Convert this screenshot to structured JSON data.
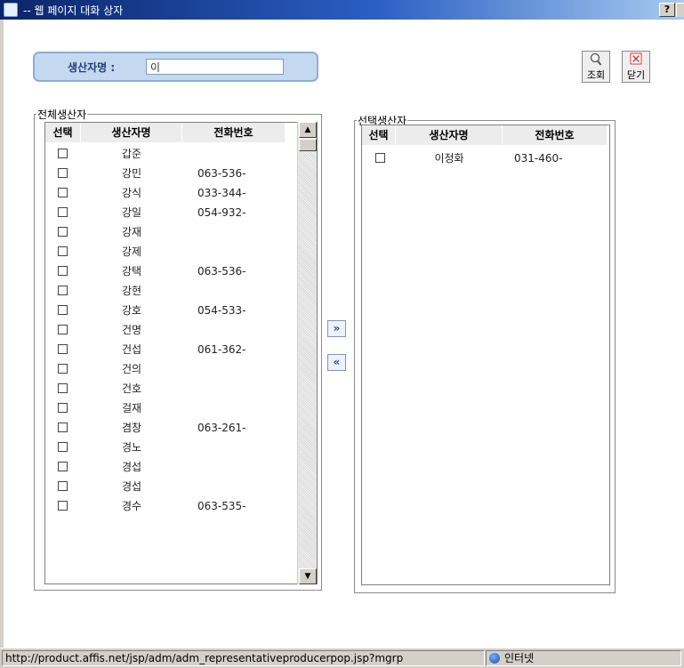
{
  "window": {
    "title": "-- 웹 페이지 대화 상자",
    "help_label": "?"
  },
  "search": {
    "label": "생산자명 :",
    "value": "이"
  },
  "toolbar": {
    "search_label": "조회",
    "search_icon": "magnifier-icon",
    "close_label": "닫기",
    "close_icon": "close-x-icon"
  },
  "all_producers": {
    "legend": "전체생산자",
    "headers": {
      "select": "선택",
      "name": "생산자명",
      "phone": "전화번호"
    },
    "rows": [
      {
        "name": "갑준",
        "phone": ""
      },
      {
        "name": "강민",
        "phone": "063-536-"
      },
      {
        "name": "강식",
        "phone": "033-344-"
      },
      {
        "name": "강일",
        "phone": "054-932-"
      },
      {
        "name": "강재",
        "phone": ""
      },
      {
        "name": "강제",
        "phone": ""
      },
      {
        "name": "강택",
        "phone": "063-536-"
      },
      {
        "name": "강현",
        "phone": ""
      },
      {
        "name": "강호",
        "phone": "054-533-"
      },
      {
        "name": "건명",
        "phone": ""
      },
      {
        "name": "건섭",
        "phone": "061-362-"
      },
      {
        "name": "건의",
        "phone": ""
      },
      {
        "name": "건호",
        "phone": ""
      },
      {
        "name": "걸재",
        "phone": ""
      },
      {
        "name": "겸창",
        "phone": "063-261-"
      },
      {
        "name": "경노",
        "phone": ""
      },
      {
        "name": "경섭",
        "phone": ""
      },
      {
        "name": "경섭",
        "phone": ""
      },
      {
        "name": "경수",
        "phone": "063-535-"
      }
    ]
  },
  "move_buttons": {
    "add": "»",
    "remove": "«"
  },
  "selected_producers": {
    "legend": "선택생산자",
    "headers": {
      "select": "선택",
      "name": "생산자명",
      "phone": "전화번호"
    },
    "rows": [
      {
        "name": "이정화",
        "phone": "031-460-"
      }
    ]
  },
  "statusbar": {
    "url": "http://product.affis.net/jsp/adm/adm_representativeproducerpop.jsp?mgrp",
    "zone": "인터넷"
  }
}
